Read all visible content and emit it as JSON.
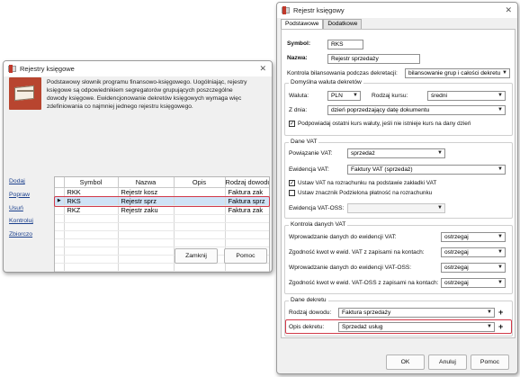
{
  "left_window": {
    "title": "Rejestry księgowe",
    "description": "Podstawowy słownik programu finansowo-księgowego. Uogólniając, rejestry księgowe są odpowiednikiem segregatorów grupujących poszczególne dowody księgowe. Ewidencjonowanie dekretów księgowych wymaga więc zdefiniowania co najmniej jednego rejestru księgowego.",
    "side_links": [
      "Dodaj",
      "Popraw",
      "Usuń",
      "Kontroluj",
      "Zbiorczo"
    ],
    "table": {
      "columns": [
        "Symbol",
        "Nazwa",
        "Opis",
        "Rodzaj dowodu"
      ],
      "rows": [
        {
          "symbol": "RKK",
          "nazwa": "Rejestr kosz",
          "opis": "",
          "rodzaj": "Faktura zak"
        },
        {
          "symbol": "RKS",
          "nazwa": "Rejestr sprz",
          "opis": "",
          "rodzaj": "Faktura sprz",
          "selected": true
        },
        {
          "symbol": "RKZ",
          "nazwa": "Rejestr zaku",
          "opis": "",
          "rodzaj": "Faktura zak"
        }
      ],
      "row_indicator": "▶"
    },
    "buttons": {
      "close": "Zamknij",
      "help": "Pomoc"
    }
  },
  "right_window": {
    "title": "Rejestr księgowy",
    "tabs": [
      "Podstawowe",
      "Dodatkowe"
    ],
    "symbol_label": "Symbol:",
    "symbol_value": "RKS",
    "nazwa_label": "Nazwa:",
    "nazwa_value": "Rejestr sprzedaży",
    "kontrola_label": "Kontrola bilansowania podczas dekretacji:",
    "kontrola_value": "bilansowanie grup i całości dekretu",
    "waluta_group": {
      "title": "Domyślna waluta dekretów",
      "waluta_label": "Waluta:",
      "waluta_value": "PLN",
      "rodzaj_kursu_label": "Rodzaj kursu:",
      "rodzaj_kursu_value": "średni",
      "zdnia_label": "Z dnia:",
      "zdnia_value": "dzień poprzedzający datę dokumentu",
      "checkbox_label": "Podpowiadaj ostatni kurs waluty, jeśli nie istnieje kurs na dany dzień",
      "checkbox_checked": true
    },
    "vat_group": {
      "title": "Dane VAT",
      "powiazanie_label": "Powiązanie VAT:",
      "powiazanie_value": "sprzedaż",
      "ewidencja_label": "Ewidencja VAT:",
      "ewidencja_value": "Faktury VAT (sprzedaż)",
      "check1_label": "Ustaw VAT na rozrachunku na podstawie zakładki VAT",
      "check1_checked": true,
      "check2_label": "Ustaw znacznik Podzielona płatność na rozrachunku",
      "check2_checked": false,
      "ewidencja_oss_label": "Ewidencja VAT-OSS:",
      "ewidencja_oss_value": ""
    },
    "kontrola_vat_group": {
      "title": "Kontrola danych VAT",
      "rows": [
        {
          "label": "Wprowadzanie danych do ewidencji VAT:",
          "value": "ostrzegaj"
        },
        {
          "label": "Zgodność kwot w ewid. VAT z zapisami na kontach:",
          "value": "ostrzegaj"
        },
        {
          "label": "Wprowadzanie danych do ewidencji VAT-OSS:",
          "value": "ostrzegaj"
        },
        {
          "label": "Zgodność kwot w ewid. VAT-OSS z zapisami na kontach:",
          "value": "ostrzegaj"
        }
      ]
    },
    "dekret_group": {
      "title": "Dane dekretu",
      "rodzaj_label": "Rodzaj dowodu:",
      "rodzaj_value": "Faktura sprzedaży",
      "opis_label": "Opis dekretu:",
      "opis_value": "Sprzedaż usług"
    },
    "buttons": {
      "ok": "OK",
      "cancel": "Anuluj",
      "help": "Pomoc"
    }
  },
  "colors": {
    "highlight_border": "#d23a4a",
    "selected_row": "#cfe3f6",
    "link": "#1a3f8c"
  }
}
